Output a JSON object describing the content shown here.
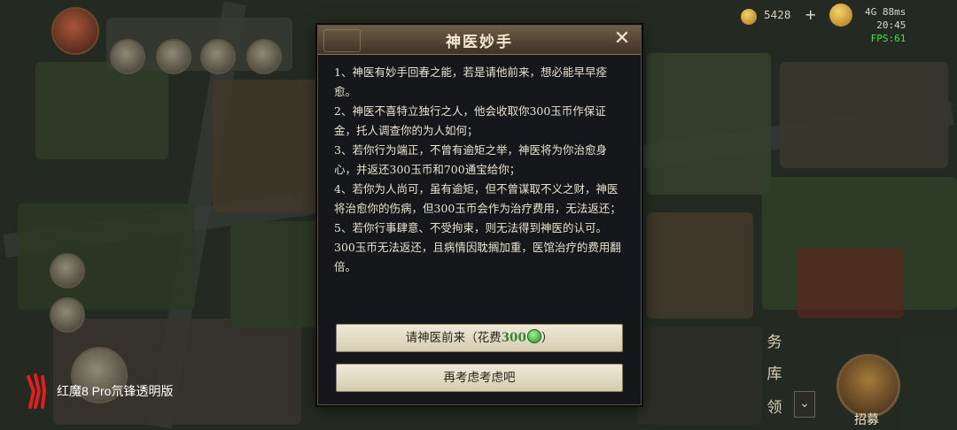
{
  "hud": {
    "resource_value": "5428",
    "network": "4G 88ms",
    "clock": "20:45",
    "fps": "FPS:61",
    "recruit_label": "招募",
    "right_tabs": [
      "务",
      "库",
      "领"
    ],
    "colors": {
      "fps": "#3ee05a"
    }
  },
  "watermark": {
    "text": "红魔8 Pro氘锋透明版"
  },
  "dialog": {
    "title": "神医妙手",
    "rules": [
      "1、神医有妙手回春之能，若是请他前来，想必能早早痊愈。",
      "2、神医不喜特立独行之人，他会收取你300玉币作保证金，托人调查你的为人如何；",
      "3、若你行为端正，不曾有逾矩之举，神医将为你治愈身心，并返还300玉币和700通宝给你；",
      "4、若你为人尚可，虽有逾矩，但不曾谋取不义之财，神医将治愈你的伤病，但300玉币会作为治疗费用，无法返还；",
      "5、若你行事肆意、不受拘束，则无法得到神医的认可。300玉币无法返还，且病情因耽搁加重，医馆治疗的费用翻倍。"
    ],
    "invite_label": "请神医前来（花费",
    "invite_cost": "300",
    "invite_suffix": "）",
    "reconsider_label": "再考虑考虑吧",
    "cost_icon": "jade-coin-icon",
    "colors": {
      "cost": "#2b8a2f",
      "button_bg": "#e6dcc4",
      "dialog_bg": "#16171a"
    }
  }
}
